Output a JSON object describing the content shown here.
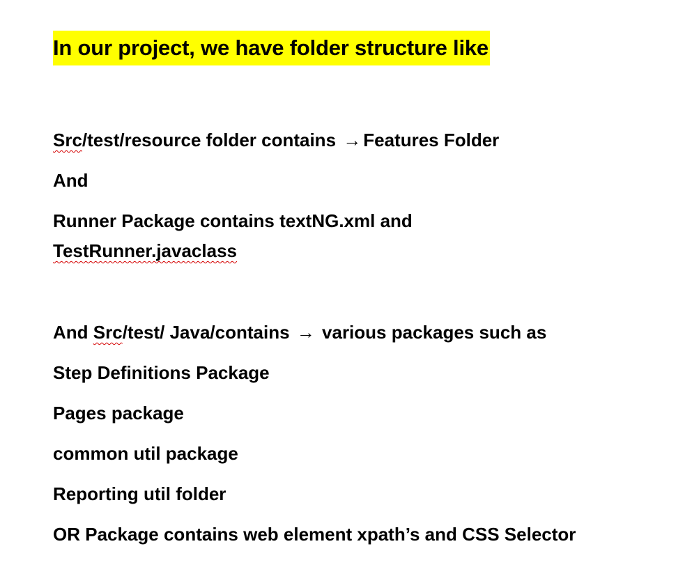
{
  "heading": {
    "text": "In our project, we have folder structure like",
    "highlight_color": "#ffff00"
  },
  "lines": {
    "resource": {
      "path": "Src",
      "rest": "/test/resource folder contains ",
      "arrow": "→",
      "target": "Features Folder"
    },
    "and1": "And",
    "runner1": "Runner Package contains textNG.xml and",
    "runner2": "TestRunner.javaclass",
    "java": {
      "prefix": "And ",
      "path": "Src",
      "rest": "/test/ Java/contains ",
      "arrow": "→",
      "target": " various packages such as"
    },
    "step": "Step Definitions Package",
    "pages": "Pages package",
    "common": "common util package",
    "reporting": "Reporting util folder",
    "or": "OR Package contains web element xpath’s and CSS Selector"
  },
  "spellcheck_color": "#d40000"
}
